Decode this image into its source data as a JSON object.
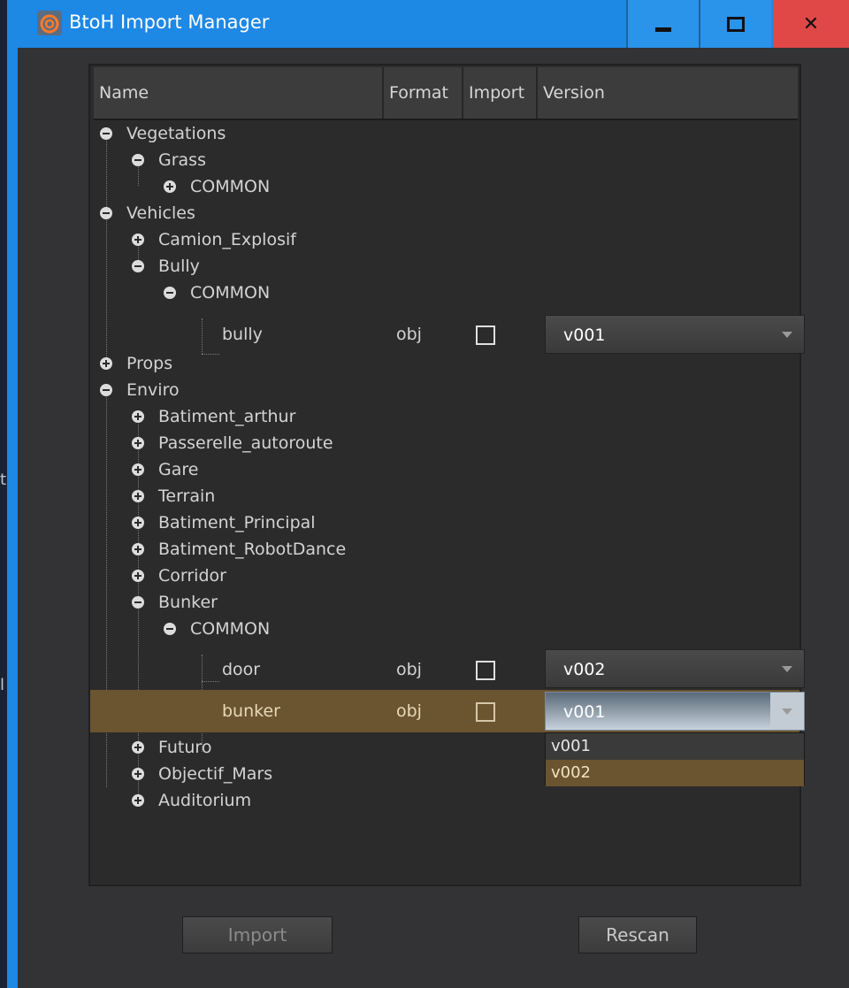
{
  "window": {
    "title": "BtoH Import Manager"
  },
  "desktop": {
    "edge_chars": [
      "t",
      "l"
    ]
  },
  "tree": {
    "columns": [
      "Name",
      "Format",
      "Import",
      "Version"
    ],
    "nodes": [
      {
        "label": "Vegetations"
      },
      {
        "label": "Grass"
      },
      {
        "label": "COMMON"
      },
      {
        "label": "Vehicles"
      },
      {
        "label": "Camion_Explosif"
      },
      {
        "label": "Bully"
      },
      {
        "label": "COMMON"
      },
      {
        "label": "bully",
        "format": "obj",
        "version": "v001"
      },
      {
        "label": "Props"
      },
      {
        "label": "Enviro"
      },
      {
        "label": "Batiment_arthur"
      },
      {
        "label": "Passerelle_autoroute"
      },
      {
        "label": "Gare"
      },
      {
        "label": "Terrain"
      },
      {
        "label": "Batiment_Principal"
      },
      {
        "label": "Batiment_RobotDance"
      },
      {
        "label": "Corridor"
      },
      {
        "label": "Bunker"
      },
      {
        "label": "COMMON"
      },
      {
        "label": "door",
        "format": "obj",
        "version": "v002"
      },
      {
        "label": "bunker",
        "format": "obj",
        "version": "v001"
      },
      {
        "label": "Futuro"
      },
      {
        "label": "Objectif_Mars"
      },
      {
        "label": "Auditorium"
      }
    ],
    "version_options": [
      "v001",
      "v002"
    ]
  },
  "buttons": {
    "import": "Import",
    "rescan": "Rescan"
  }
}
